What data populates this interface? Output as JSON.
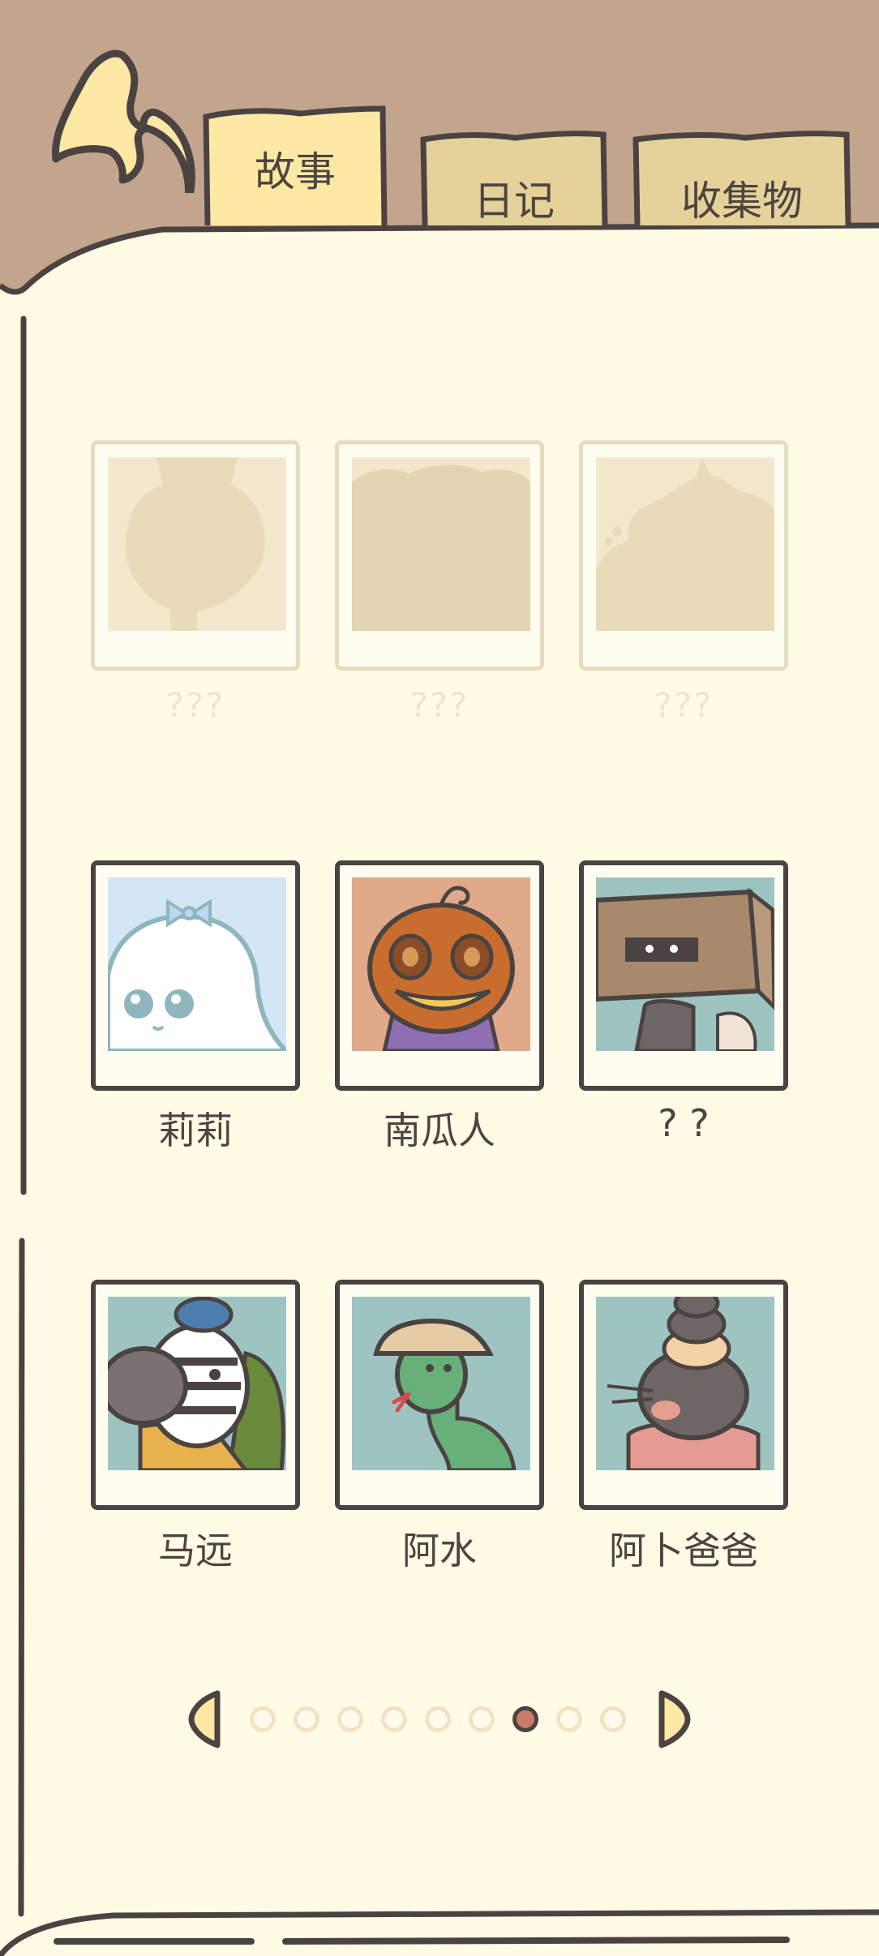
{
  "tabs": [
    {
      "label": "故事",
      "active": true
    },
    {
      "label": "日记",
      "active": false
    },
    {
      "label": "收集物",
      "active": false
    }
  ],
  "colors": {
    "header_bg": "#c3a58e",
    "page_bg": "#fffbe4",
    "tab_active": "#fde8a4",
    "tab_inactive": "#e4d29a",
    "outline": "#4a4341",
    "locked_frame": "#e7dcc0",
    "page_dot_active": "#c87c69"
  },
  "characters": [
    {
      "name": "???",
      "locked": true,
      "icon": "silhouette-1"
    },
    {
      "name": "???",
      "locked": true,
      "icon": "silhouette-2"
    },
    {
      "name": "???",
      "locked": true,
      "icon": "silhouette-3"
    },
    {
      "name": "莉莉",
      "locked": false,
      "icon": "ghost-portrait"
    },
    {
      "name": "南瓜人",
      "locked": false,
      "icon": "pumpkin-portrait"
    },
    {
      "name": "? ?",
      "locked": false,
      "icon": "box-portrait"
    },
    {
      "name": "马远",
      "locked": false,
      "icon": "zebra-portrait"
    },
    {
      "name": "阿水",
      "locked": false,
      "icon": "snake-portrait"
    },
    {
      "name": "阿卜爸爸",
      "locked": false,
      "icon": "mole-portrait"
    }
  ],
  "pagination": {
    "total": 9,
    "current": 7
  }
}
